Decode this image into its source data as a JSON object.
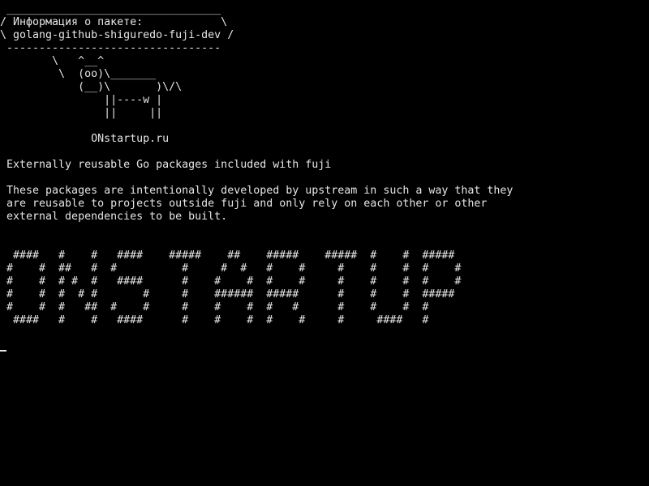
{
  "terminal": {
    "lines": [
      " _________________________________",
      "/ Информация о пакете:            \\",
      "\\ golang-github-shiguredo-fuji-dev /",
      " ---------------------------------",
      "        \\   ^__^",
      "         \\  (oo)\\_______",
      "            (__)\\       )\\/\\",
      "                ||----w |",
      "                ||     ||",
      "",
      "              ONstartup.ru",
      "",
      " Externally reusable Go packages included with fuji",
      "",
      " These packages are intentionally developed by upstream in such a way that they",
      " are reusable to projects outside fuji and only rely on each other or other",
      " external dependencies to be built.",
      "",
      "",
      "  ####   #    #   ####    #####    ##    #####    #####  #    #  #####",
      " #    #  ##   #  #          #     #  #   #    #     #    #    #  #    #",
      " #    #  # #  #   ####      #    #    #  #    #     #    #    #  #    #",
      " #    #  #  # #       #     #    ######  #####      #    #    #  #####",
      " #    #  #   ##  #    #     #    #    #  #   #      #    #    #  #",
      "  ####   #    #   ####      #    #    #  #    #     #     ####   #",
      ""
    ],
    "colors": {
      "background": "#000000",
      "foreground": "#e6e6e6"
    }
  }
}
